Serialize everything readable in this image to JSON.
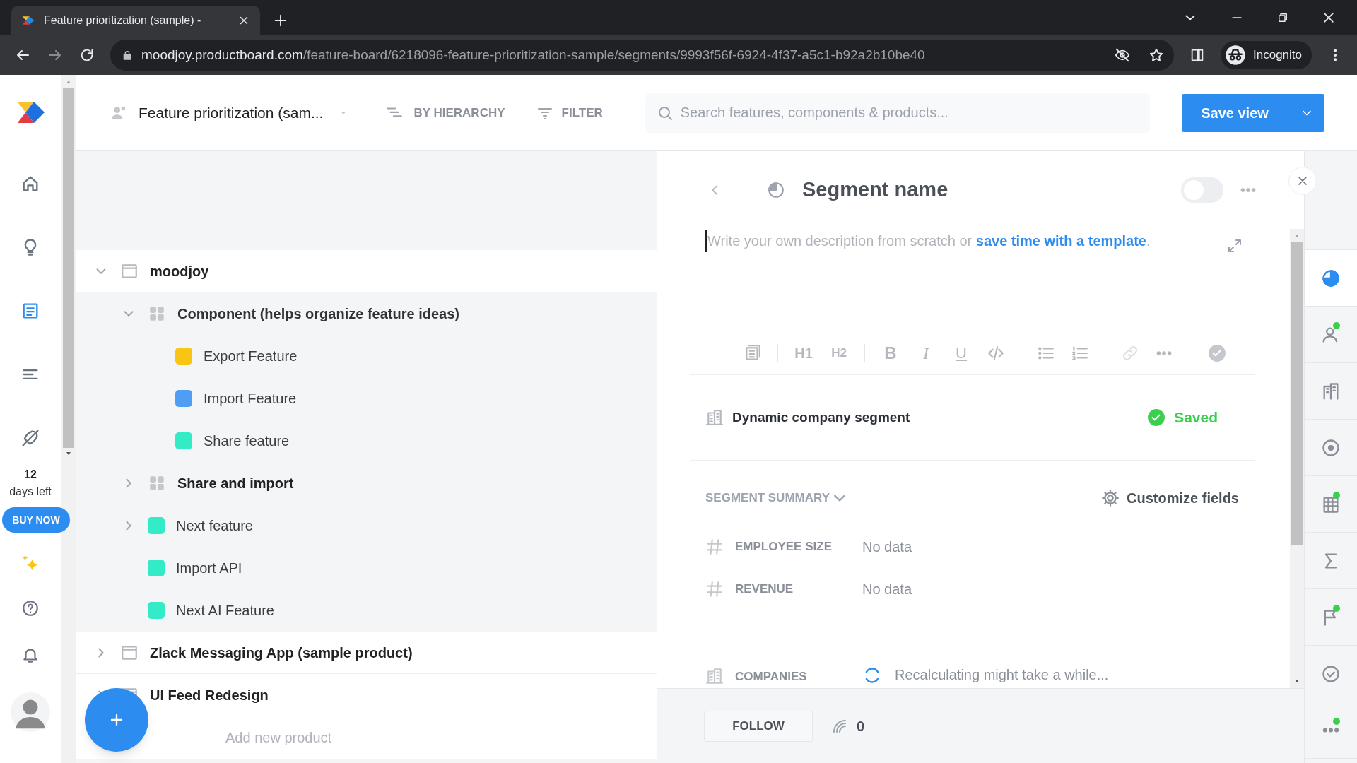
{
  "browser": {
    "tab_title": "Feature prioritization (sample) -",
    "url_host": "moodjoy.productboard.com",
    "url_path": "/feature-board/6218096-feature-prioritization-sample/segments/9993f56f-6924-4f37-a5c1-b92a2b10be40",
    "profile": "Incognito"
  },
  "nav": [
    {
      "selected": false
    },
    {
      "selected": false
    },
    {
      "selected": true
    },
    {
      "selected": false
    },
    {
      "selected": false
    }
  ],
  "trial": {
    "days": "12",
    "label": "days left",
    "button": "BUY NOW"
  },
  "header": {
    "board": "Feature prioritization (sam...",
    "grouping": "BY HIERARCHY",
    "filter": "FILTER",
    "search_placeholder": "Search features, components & products...",
    "save": "Save view"
  },
  "tree": [
    {
      "kind": "product",
      "label": "moodjoy",
      "expanded": true,
      "children": [
        {
          "kind": "component",
          "label": "Component (helps organize feature ideas)",
          "expanded": true,
          "children": [
            {
              "kind": "feature",
              "label": "Export Feature",
              "color": "#f9c513"
            },
            {
              "kind": "feature",
              "label": "Import Feature",
              "color": "#4f9ef5"
            },
            {
              "kind": "feature",
              "label": "Share feature",
              "color": "#33ebc6"
            }
          ]
        },
        {
          "kind": "component",
          "label": "Share and import",
          "expanded": false
        },
        {
          "kind": "feature",
          "label": "Next feature",
          "color": "#33ebc6",
          "expanded": false
        },
        {
          "kind": "feature",
          "label": "Import API",
          "color": "#33ebc6"
        },
        {
          "kind": "feature",
          "label": "Next AI Feature",
          "color": "#33ebc6"
        }
      ]
    },
    {
      "kind": "product",
      "label": "Zlack Messaging App (sample product)",
      "expanded": false
    },
    {
      "kind": "product",
      "label": "UI Feed Redesign",
      "expanded": false
    }
  ],
  "add_product_placeholder": "Add new product",
  "panel": {
    "title": "Segment name",
    "enabled": false,
    "description": {
      "placeholder": "Write your own description from scratch or",
      "link": "save time with a template",
      "end": "."
    },
    "toolbar": [
      "H1",
      "H2",
      "B",
      "I",
      "U"
    ],
    "segment_type": "Dynamic company segment",
    "status": "Saved",
    "summary_label": "SEGMENT SUMMARY",
    "customize": "Customize fields",
    "fields": [
      {
        "label": "EMPLOYEE SIZE",
        "value": "No data"
      },
      {
        "label": "REVENUE",
        "value": "No data"
      }
    ],
    "companies": {
      "label": "COMPANIES",
      "value": "Recalculating might take a while..."
    },
    "follow": "FOLLOW",
    "followers": "0"
  },
  "rail": [
    {
      "selected": true,
      "badge": false
    },
    {
      "selected": false,
      "badge": true
    },
    {
      "selected": false,
      "badge": false
    },
    {
      "selected": false,
      "badge": false
    },
    {
      "selected": false,
      "badge": true
    },
    {
      "selected": false,
      "badge": false
    },
    {
      "selected": false,
      "badge": true
    },
    {
      "selected": false,
      "badge": false
    },
    {
      "selected": false,
      "badge": true
    }
  ]
}
